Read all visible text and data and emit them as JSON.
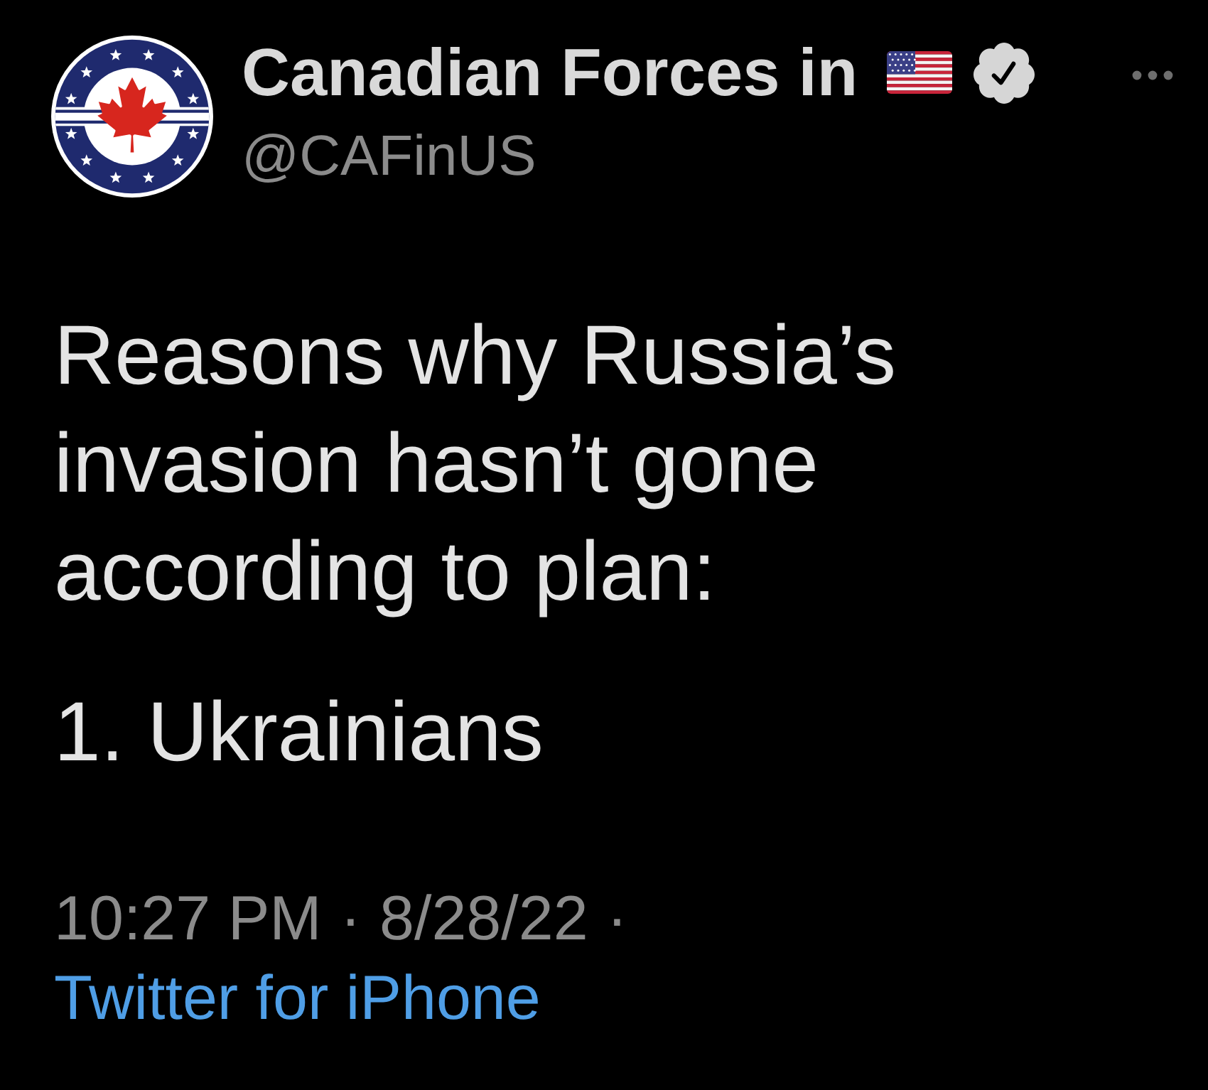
{
  "tweet": {
    "author": {
      "name": "Canadian Forces in",
      "handle": "@CAFinUS",
      "verified": true
    },
    "paragraphs": [
      "Reasons why Russia’s invasion hasn’t gone according to plan:",
      "1. Ukrainians"
    ],
    "meta": [
      {
        "kind": "time",
        "text": "10:27 PM"
      },
      {
        "kind": "separator",
        "text": "·"
      },
      {
        "kind": "date",
        "text": "8/28/22"
      },
      {
        "kind": "separator",
        "text": "·"
      },
      {
        "kind": "link",
        "text": "Twitter for iPhone"
      }
    ]
  }
}
